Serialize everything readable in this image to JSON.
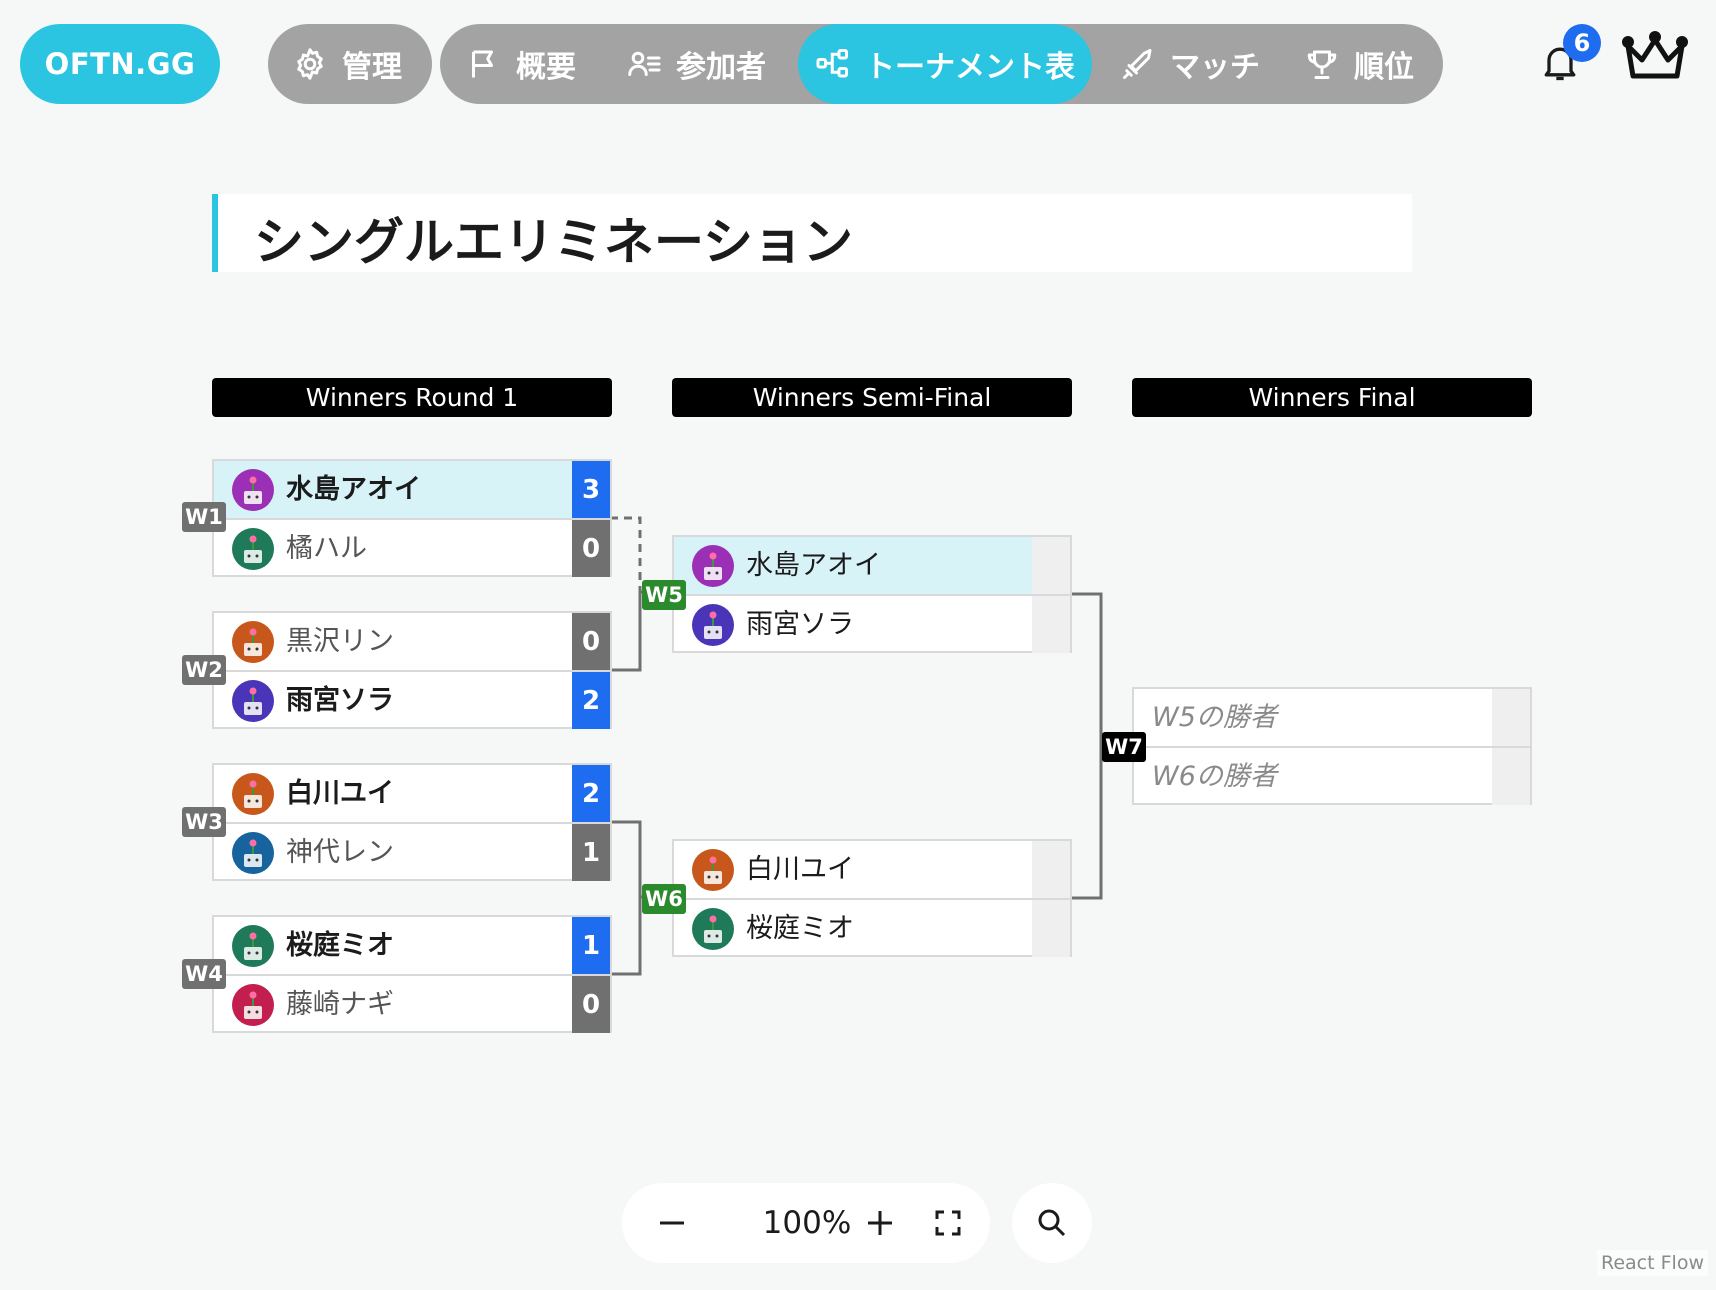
{
  "header": {
    "logo": "OFTN.GG",
    "nav": [
      {
        "label": "管理",
        "icon": "gear-icon"
      },
      {
        "label": "概要",
        "icon": "flag-icon"
      },
      {
        "label": "参加者",
        "icon": "participants-icon"
      },
      {
        "label": "トーナメント表",
        "icon": "bracket-icon",
        "active": true
      },
      {
        "label": "マッチ",
        "icon": "sword-icon"
      },
      {
        "label": "順位",
        "icon": "trophy-icon"
      }
    ],
    "notifications": {
      "count": "6",
      "icon": "bell-icon"
    },
    "profile_icon": "crown-icon",
    "accent_color": "#2bc4e1"
  },
  "bracket": {
    "title": "シングルエリミネーション",
    "rounds": [
      "Winners Round 1",
      "Winners Semi-Final",
      "Winners Final"
    ],
    "matches": [
      {
        "label": "W1",
        "players": [
          {
            "name": "水島アオイ",
            "score": "3",
            "winner": true
          },
          {
            "name": "橘ハル",
            "score": "0",
            "winner": false
          }
        ]
      },
      {
        "label": "W2",
        "players": [
          {
            "name": "黒沢リン",
            "score": "0",
            "winner": false
          },
          {
            "name": "雨宮ソラ",
            "score": "2",
            "winner": true
          }
        ]
      },
      {
        "label": "W3",
        "players": [
          {
            "name": "白川ユイ",
            "score": "2",
            "winner": true
          },
          {
            "name": "神代レン",
            "score": "1",
            "winner": false
          }
        ]
      },
      {
        "label": "W4",
        "players": [
          {
            "name": "桜庭ミオ",
            "score": "1",
            "winner": true
          },
          {
            "name": "藤崎ナギ",
            "score": "0",
            "winner": false
          }
        ]
      },
      {
        "label": "W5",
        "players": [
          {
            "name": "水島アオイ",
            "score": ""
          },
          {
            "name": "雨宮ソラ",
            "score": ""
          }
        ]
      },
      {
        "label": "W6",
        "players": [
          {
            "name": "白川ユイ",
            "score": ""
          },
          {
            "name": "桜庭ミオ",
            "score": ""
          }
        ]
      },
      {
        "label": "W7",
        "players": [
          {
            "name": "W5の勝者",
            "score": ""
          },
          {
            "name": "W6の勝者",
            "score": ""
          }
        ]
      }
    ],
    "colors": {
      "winner_score": "#1e6cf0",
      "loser_score": "#707070",
      "winner_row": "#d8f3f8",
      "label_done": "#707070",
      "label_ready": "#2b8a2b",
      "label_pending": "#000000"
    }
  },
  "controls": {
    "zoom_level": "100%",
    "zoom_out_icon": "minus-icon",
    "zoom_in_icon": "plus-icon",
    "fit_view_icon": "fit-view-icon",
    "search_icon": "search-icon"
  },
  "attribution": "React Flow"
}
